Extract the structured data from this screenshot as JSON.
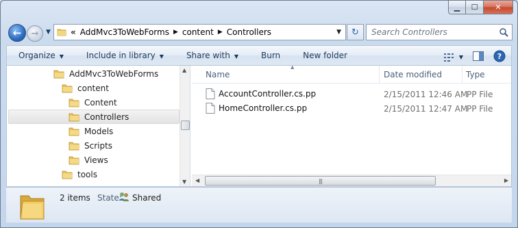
{
  "window": {
    "caption": {
      "minimize": "▁",
      "maximize": "☐",
      "close": "✕"
    }
  },
  "nav": {
    "back_icon": "back-arrow",
    "forward_icon": "forward-arrow",
    "address": {
      "overflow": "«",
      "crumbs": [
        "AddMvc3ToWebForms",
        "content",
        "Controllers"
      ]
    },
    "search_placeholder": "Search Controllers"
  },
  "toolbar": {
    "organize": "Organize",
    "include_in_library": "Include in library",
    "share_with": "Share with",
    "burn": "Burn",
    "new_folder": "New folder"
  },
  "tree": {
    "items": [
      {
        "label": "AddMvc3ToWebForms",
        "level": 0
      },
      {
        "label": "content",
        "level": 1
      },
      {
        "label": "Content",
        "level": 2
      },
      {
        "label": "Controllers",
        "level": 2,
        "selected": true
      },
      {
        "label": "Models",
        "level": 2
      },
      {
        "label": "Scripts",
        "level": 2
      },
      {
        "label": "Views",
        "level": 2
      },
      {
        "label": "tools",
        "level": 1
      }
    ]
  },
  "files": {
    "columns": {
      "name": "Name",
      "date": "Date modified",
      "type": "Type"
    },
    "rows": [
      {
        "name": "AccountController.cs.pp",
        "date": "2/15/2011 12:46 AM",
        "type": "PP File"
      },
      {
        "name": "HomeController.cs.pp",
        "date": "2/15/2011 12:47 AM",
        "type": "PP File"
      }
    ]
  },
  "details": {
    "count": "2 items",
    "state_label": "State:",
    "state_value": "Shared"
  },
  "colors": {
    "folder": "#e8c35a",
    "accent": "#2c66b3"
  }
}
